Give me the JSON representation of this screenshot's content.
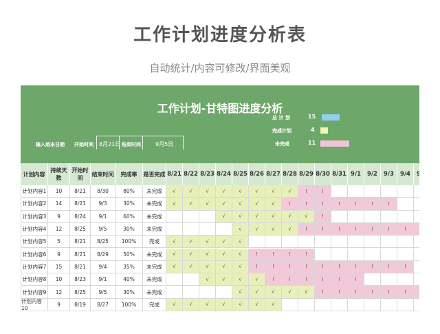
{
  "page": {
    "title": "工作计划进度分析表",
    "subtitle": "自动统计/内容可修改/界面美观"
  },
  "banner": {
    "title": "工作计划-甘特图进度分析",
    "input_label": "输入始末日期",
    "start_label": "开始时间",
    "start_value": "8月21日",
    "end_label": "结束时间",
    "end_value": "9月5日",
    "stats": [
      {
        "label": "总 计 划",
        "value": "15",
        "color": "#8fd0ee"
      },
      {
        "label": "完成计划",
        "value": "4",
        "color": "#f2f5b4"
      },
      {
        "label": "未完成",
        "value": "11",
        "color": "#f2c4d6"
      }
    ]
  },
  "table": {
    "headers": [
      "计划内容",
      "持续天数",
      "开始时间",
      "结束时间",
      "完成率",
      "是否完成"
    ],
    "dates": [
      "8/21",
      "8/22",
      "8/23",
      "8/24",
      "8/25",
      "8/26",
      "8/27",
      "8/28",
      "8/29",
      "8/30",
      "8/31",
      "9/1",
      "9/2",
      "9/3",
      "9/4",
      "9/5"
    ],
    "done_mark": "√",
    "todo_mark": "!",
    "rows": [
      {
        "name": "计划内容1",
        "days": "10",
        "start": "8/21",
        "end": "8/30",
        "rate": "80%",
        "status": "未完成",
        "cells": "GGGGGGGGPP000000"
      },
      {
        "name": "计划内容2",
        "days": "14",
        "start": "8/21",
        "end": "9/3",
        "rate": "30%",
        "status": "未完成",
        "cells": "GGGGGGGPPPPPPP00"
      },
      {
        "name": "计划内容3",
        "days": "9",
        "start": "8/24",
        "end": "9/1",
        "rate": "60%",
        "status": "未完成",
        "cells": "000GGGGGGP000000"
      },
      {
        "name": "计划内容4",
        "days": "12",
        "start": "8/25",
        "end": "9/5",
        "rate": "30%",
        "status": "未完成",
        "cells": "0000GGGGPPPPPPPP"
      },
      {
        "name": "计划内容5",
        "days": "5",
        "start": "8/21",
        "end": "8/25",
        "rate": "100%",
        "status": "完成",
        "cells": "GGGGG00000000000"
      },
      {
        "name": "计划内容6",
        "days": "9",
        "start": "8/21",
        "end": "8/29",
        "rate": "50%",
        "status": "未完成",
        "cells": "GGGGGPPPP0000000"
      },
      {
        "name": "计划内容7",
        "days": "15",
        "start": "8/21",
        "end": "9/4",
        "rate": "35%",
        "status": "未完成",
        "cells": "GGGGGPPPPPPPPPP0"
      },
      {
        "name": "计划内容8",
        "days": "10",
        "start": "8/23",
        "end": "9/1",
        "rate": "40%",
        "status": "未完成",
        "cells": "00GGGGPPPPPP0000"
      },
      {
        "name": "计划内容9",
        "days": "12",
        "start": "8/25",
        "end": "9/5",
        "rate": "30%",
        "status": "未完成",
        "cells": "0000GGGGGPPPPPPP"
      },
      {
        "name": "计划内容10",
        "days": "9",
        "start": "8/19",
        "end": "8/27",
        "rate": "100%",
        "status": "完成",
        "cells": "GGGGGGG000000000"
      }
    ]
  }
}
